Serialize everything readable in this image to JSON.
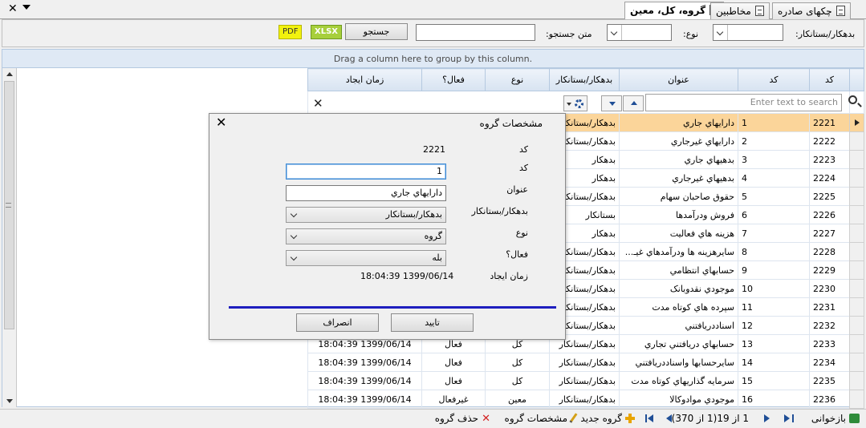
{
  "tabs": [
    {
      "label": "گروه، کل، معین",
      "active": true
    },
    {
      "label": "مخاطبين",
      "active": false
    },
    {
      "label": "چکهای صادره",
      "active": false
    }
  ],
  "search_bar": {
    "party_label": "بدهکار/بستانکار:",
    "type_label": "نوع:",
    "search_text_label": "متن جستجو:",
    "search_button": "جستجو",
    "xlsx_label": "XLSX",
    "pdf_label": "PDF"
  },
  "grid": {
    "group_panel_text": "Drag a column here to group by this column.",
    "filter_placeholder": "Enter text to search",
    "columns": [
      "کد",
      "کد",
      "عنوان",
      "بدهکار/بستانکار",
      "نوع",
      "فعال؟",
      "زمان ایجاد"
    ],
    "rows": [
      {
        "code": "2221",
        "num": "1",
        "title": "دارايهاي جاري",
        "party": "بدهکار/بستانکار",
        "type": "",
        "active": "",
        "time": ""
      },
      {
        "code": "2222",
        "num": "2",
        "title": "دارايهاي غيرجاري",
        "party": "بدهکار/بستانکار",
        "type": "",
        "active": "",
        "time": ""
      },
      {
        "code": "2223",
        "num": "3",
        "title": "بدهيهاي جاري",
        "party": "بدهکار",
        "type": "",
        "active": "",
        "time": ""
      },
      {
        "code": "2224",
        "num": "4",
        "title": "بدهيهاي غيرجاري",
        "party": "بدهکار",
        "type": "",
        "active": "",
        "time": ""
      },
      {
        "code": "2225",
        "num": "5",
        "title": "حقوق صاحبان سهام",
        "party": "بدهکار/بستانکار",
        "type": "",
        "active": "",
        "time": ""
      },
      {
        "code": "2226",
        "num": "6",
        "title": "فروش ودرآمدها",
        "party": "بستانکار",
        "type": "",
        "active": "",
        "time": ""
      },
      {
        "code": "2227",
        "num": "7",
        "title": "هزينه هاي فعاليت",
        "party": "بدهکار",
        "type": "",
        "active": "",
        "time": ""
      },
      {
        "code": "2228",
        "num": "8",
        "title": "سايرهزينه ها ودرآمدهاي غيـ...",
        "party": "بدهکار/بستانکار",
        "type": "",
        "active": "",
        "time": ""
      },
      {
        "code": "2229",
        "num": "9",
        "title": "حسابهاي انتظامي",
        "party": "بدهکار/بستانکار",
        "type": "",
        "active": "",
        "time": ""
      },
      {
        "code": "2230",
        "num": "10",
        "title": "موجودي نقدوبانک",
        "party": "بدهکار/بستانکار",
        "type": "",
        "active": "",
        "time": ""
      },
      {
        "code": "2231",
        "num": "11",
        "title": "سپرده هاي کوتاه مدت",
        "party": "بدهکار/بستانکار",
        "type": "",
        "active": "",
        "time": ""
      },
      {
        "code": "2232",
        "num": "12",
        "title": "اسناددريافتني",
        "party": "بدهکار/بستانکار",
        "type": "",
        "active": "",
        "time": ""
      },
      {
        "code": "2233",
        "num": "13",
        "title": "حسابهاي دريافتني تجاري",
        "party": "بدهکار/بستانکار",
        "type": "کل",
        "active": "فعال",
        "time": "1399/06/14 18:04:39"
      },
      {
        "code": "2234",
        "num": "14",
        "title": "سايرحسابها واسناددريافتني",
        "party": "بدهکار/بستانکار",
        "type": "کل",
        "active": "فعال",
        "time": "1399/06/14 18:04:39"
      },
      {
        "code": "2235",
        "num": "15",
        "title": "سرمايه گذاريهاي کوتاه مدت",
        "party": "بدهکار/بستانکار",
        "type": "کل",
        "active": "فعال",
        "time": "1399/06/14 18:04:39"
      },
      {
        "code": "2236",
        "num": "16",
        "title": "موجودي موادوکالا",
        "party": "بدهکار/بستانکار",
        "type": "معین",
        "active": "غيرفعال",
        "time": "1399/06/14 18:04:39"
      }
    ]
  },
  "dialog": {
    "title": "مشخصات گروه",
    "code_label": "کد",
    "code_value": "2221",
    "code2_label": "کد",
    "code2_value": "1",
    "title_label": "عنوان",
    "title_value": "دارايهاي جاري",
    "party_label": "بدهکار/بستانکار",
    "party_value": "بدهکار/بستانکار",
    "type_label": "نوع",
    "type_value": "گروه",
    "active_label": "فعال؟",
    "active_value": "بله",
    "created_label": "زمان ایجاد",
    "created_value": "1399/06/14 18:04:39",
    "ok_button": "تایید",
    "cancel_button": "انصراف"
  },
  "statusbar": {
    "refresh": "بازخوانی",
    "page_info": "1 از 19(1 از 370)",
    "new_group": "گروه جدید",
    "group_props": "مشخصات گروه",
    "delete_group": "حذف گروه"
  }
}
